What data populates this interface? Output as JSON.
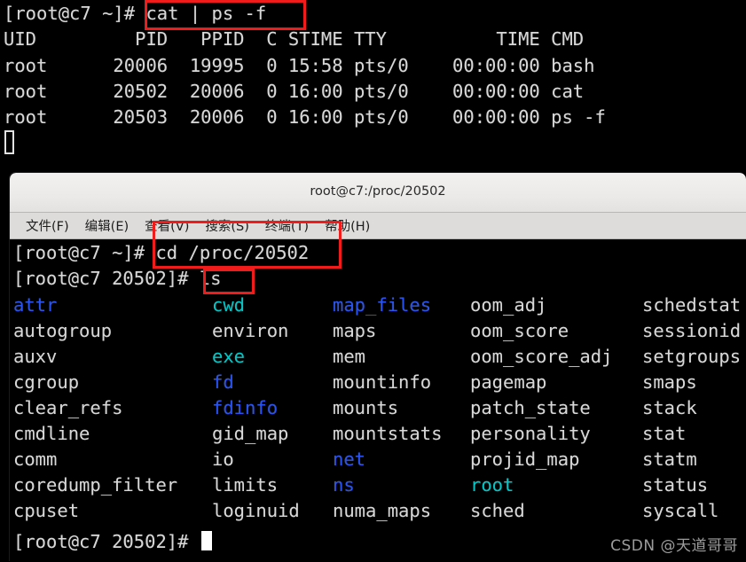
{
  "background_terminal": {
    "prompt": "[root@c7 ~]#",
    "command": "cat | ps -f",
    "line_prompt_cmd": "[root@c7 ~]# cat | ps -f",
    "ps_header": "UID         PID   PPID  C STIME TTY          TIME CMD",
    "ps_rows": [
      "root      20006  19995  0 15:58 pts/0    00:00:00 bash",
      "root      20502  20006  0 16:00 pts/0    00:00:00 cat",
      "root      20503  20006  0 16:00 pts/0    00:00:00 ps -f"
    ],
    "columns": [
      "UID",
      "PID",
      "PPID",
      "C",
      "STIME",
      "TTY",
      "TIME",
      "CMD"
    ],
    "processes": [
      {
        "uid": "root",
        "pid": "20006",
        "ppid": "19995",
        "c": "0",
        "stime": "15:58",
        "tty": "pts/0",
        "time": "00:00:00",
        "cmd": "bash"
      },
      {
        "uid": "root",
        "pid": "20502",
        "ppid": "20006",
        "c": "0",
        "stime": "16:00",
        "tty": "pts/0",
        "time": "00:00:00",
        "cmd": "cat"
      },
      {
        "uid": "root",
        "pid": "20503",
        "ppid": "20006",
        "c": "0",
        "stime": "16:00",
        "tty": "pts/0",
        "time": "00:00:00",
        "cmd": "ps -f"
      }
    ]
  },
  "window": {
    "title": "root@c7:/proc/20502",
    "menu": [
      {
        "label": "文件(F)"
      },
      {
        "label": "编辑(E)"
      },
      {
        "label": "查看(V)"
      },
      {
        "label": "搜索(S)"
      },
      {
        "label": "终端(T)"
      },
      {
        "label": "帮助(H)"
      }
    ]
  },
  "terminal": {
    "prompt_cd": "[root@c7 ~]# cd /proc/20502",
    "prompt_ls": "[root@c7 20502]# ls",
    "prompt_last": "[root@c7 20502]# ",
    "command_cd": "cd /proc/20502",
    "command_ls": "ls"
  },
  "listing": {
    "columns": [
      [
        {
          "name": "attr",
          "color": "blue"
        },
        {
          "name": "autogroup",
          "color": "white"
        },
        {
          "name": "auxv",
          "color": "white"
        },
        {
          "name": "cgroup",
          "color": "white"
        },
        {
          "name": "clear_refs",
          "color": "white"
        },
        {
          "name": "cmdline",
          "color": "white"
        },
        {
          "name": "comm",
          "color": "white"
        },
        {
          "name": "coredump_filter",
          "color": "white"
        },
        {
          "name": "cpuset",
          "color": "white"
        }
      ],
      [
        {
          "name": "cwd",
          "color": "cyan"
        },
        {
          "name": "environ",
          "color": "white"
        },
        {
          "name": "exe",
          "color": "cyan"
        },
        {
          "name": "fd",
          "color": "blue"
        },
        {
          "name": "fdinfo",
          "color": "blue"
        },
        {
          "name": "gid_map",
          "color": "white"
        },
        {
          "name": "io",
          "color": "white"
        },
        {
          "name": "limits",
          "color": "white"
        },
        {
          "name": "loginuid",
          "color": "white"
        }
      ],
      [
        {
          "name": "map_files",
          "color": "blue"
        },
        {
          "name": "maps",
          "color": "white"
        },
        {
          "name": "mem",
          "color": "white"
        },
        {
          "name": "mountinfo",
          "color": "white"
        },
        {
          "name": "mounts",
          "color": "white"
        },
        {
          "name": "mountstats",
          "color": "white"
        },
        {
          "name": "net",
          "color": "blue"
        },
        {
          "name": "ns",
          "color": "blue"
        },
        {
          "name": "numa_maps",
          "color": "white"
        }
      ],
      [
        {
          "name": "oom_adj",
          "color": "white"
        },
        {
          "name": "oom_score",
          "color": "white"
        },
        {
          "name": "oom_score_adj",
          "color": "white"
        },
        {
          "name": "pagemap",
          "color": "white"
        },
        {
          "name": "patch_state",
          "color": "white"
        },
        {
          "name": "personality",
          "color": "white"
        },
        {
          "name": "projid_map",
          "color": "white"
        },
        {
          "name": "root",
          "color": "cyan"
        },
        {
          "name": "sched",
          "color": "white"
        }
      ],
      [
        {
          "name": "schedstat",
          "color": "white"
        },
        {
          "name": "sessionid",
          "color": "white"
        },
        {
          "name": "setgroups",
          "color": "white"
        },
        {
          "name": "smaps",
          "color": "white"
        },
        {
          "name": "stack",
          "color": "white"
        },
        {
          "name": "stat",
          "color": "white"
        },
        {
          "name": "statm",
          "color": "white"
        },
        {
          "name": "status",
          "color": "white"
        },
        {
          "name": "syscall",
          "color": "white"
        }
      ]
    ]
  },
  "watermark": "CSDN @天道哥哥",
  "colors": {
    "terminal_bg": "#000000",
    "terminal_fg": "#d8d8d8",
    "dir_blue": "#2a54f0",
    "link_cyan": "#00c8c8",
    "annotation_red": "#f01c1c",
    "titlebar_bg": "#eceae8",
    "menubar_bg": "#dedcda"
  },
  "annotations": [
    {
      "name": "cat-ps-command-highlight",
      "target": "cat | ps -f"
    },
    {
      "name": "cd-command-highlight",
      "target": "cd /proc/20502"
    },
    {
      "name": "ls-command-highlight",
      "target": "ls"
    }
  ]
}
